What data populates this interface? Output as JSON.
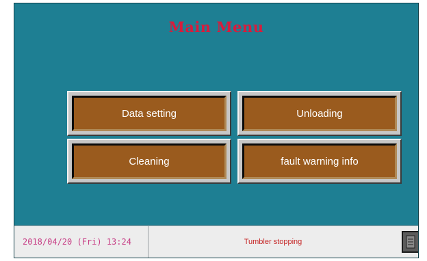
{
  "title": "Main Menu",
  "buttons": [
    {
      "label": "Data setting"
    },
    {
      "label": "Unloading"
    },
    {
      "label": "Cleaning"
    },
    {
      "label": "fault warning info"
    }
  ],
  "status": {
    "datetime": "2018/04/20 (Fri) 13:24",
    "message": "Tumbler stopping"
  },
  "colors": {
    "background": "#1e7f93",
    "title": "#d81c3c",
    "button_face": "#9a5b1e",
    "status_message": "#c62828",
    "status_time": "#c73d85"
  },
  "icons": {
    "corner_button": "panel-icon"
  }
}
